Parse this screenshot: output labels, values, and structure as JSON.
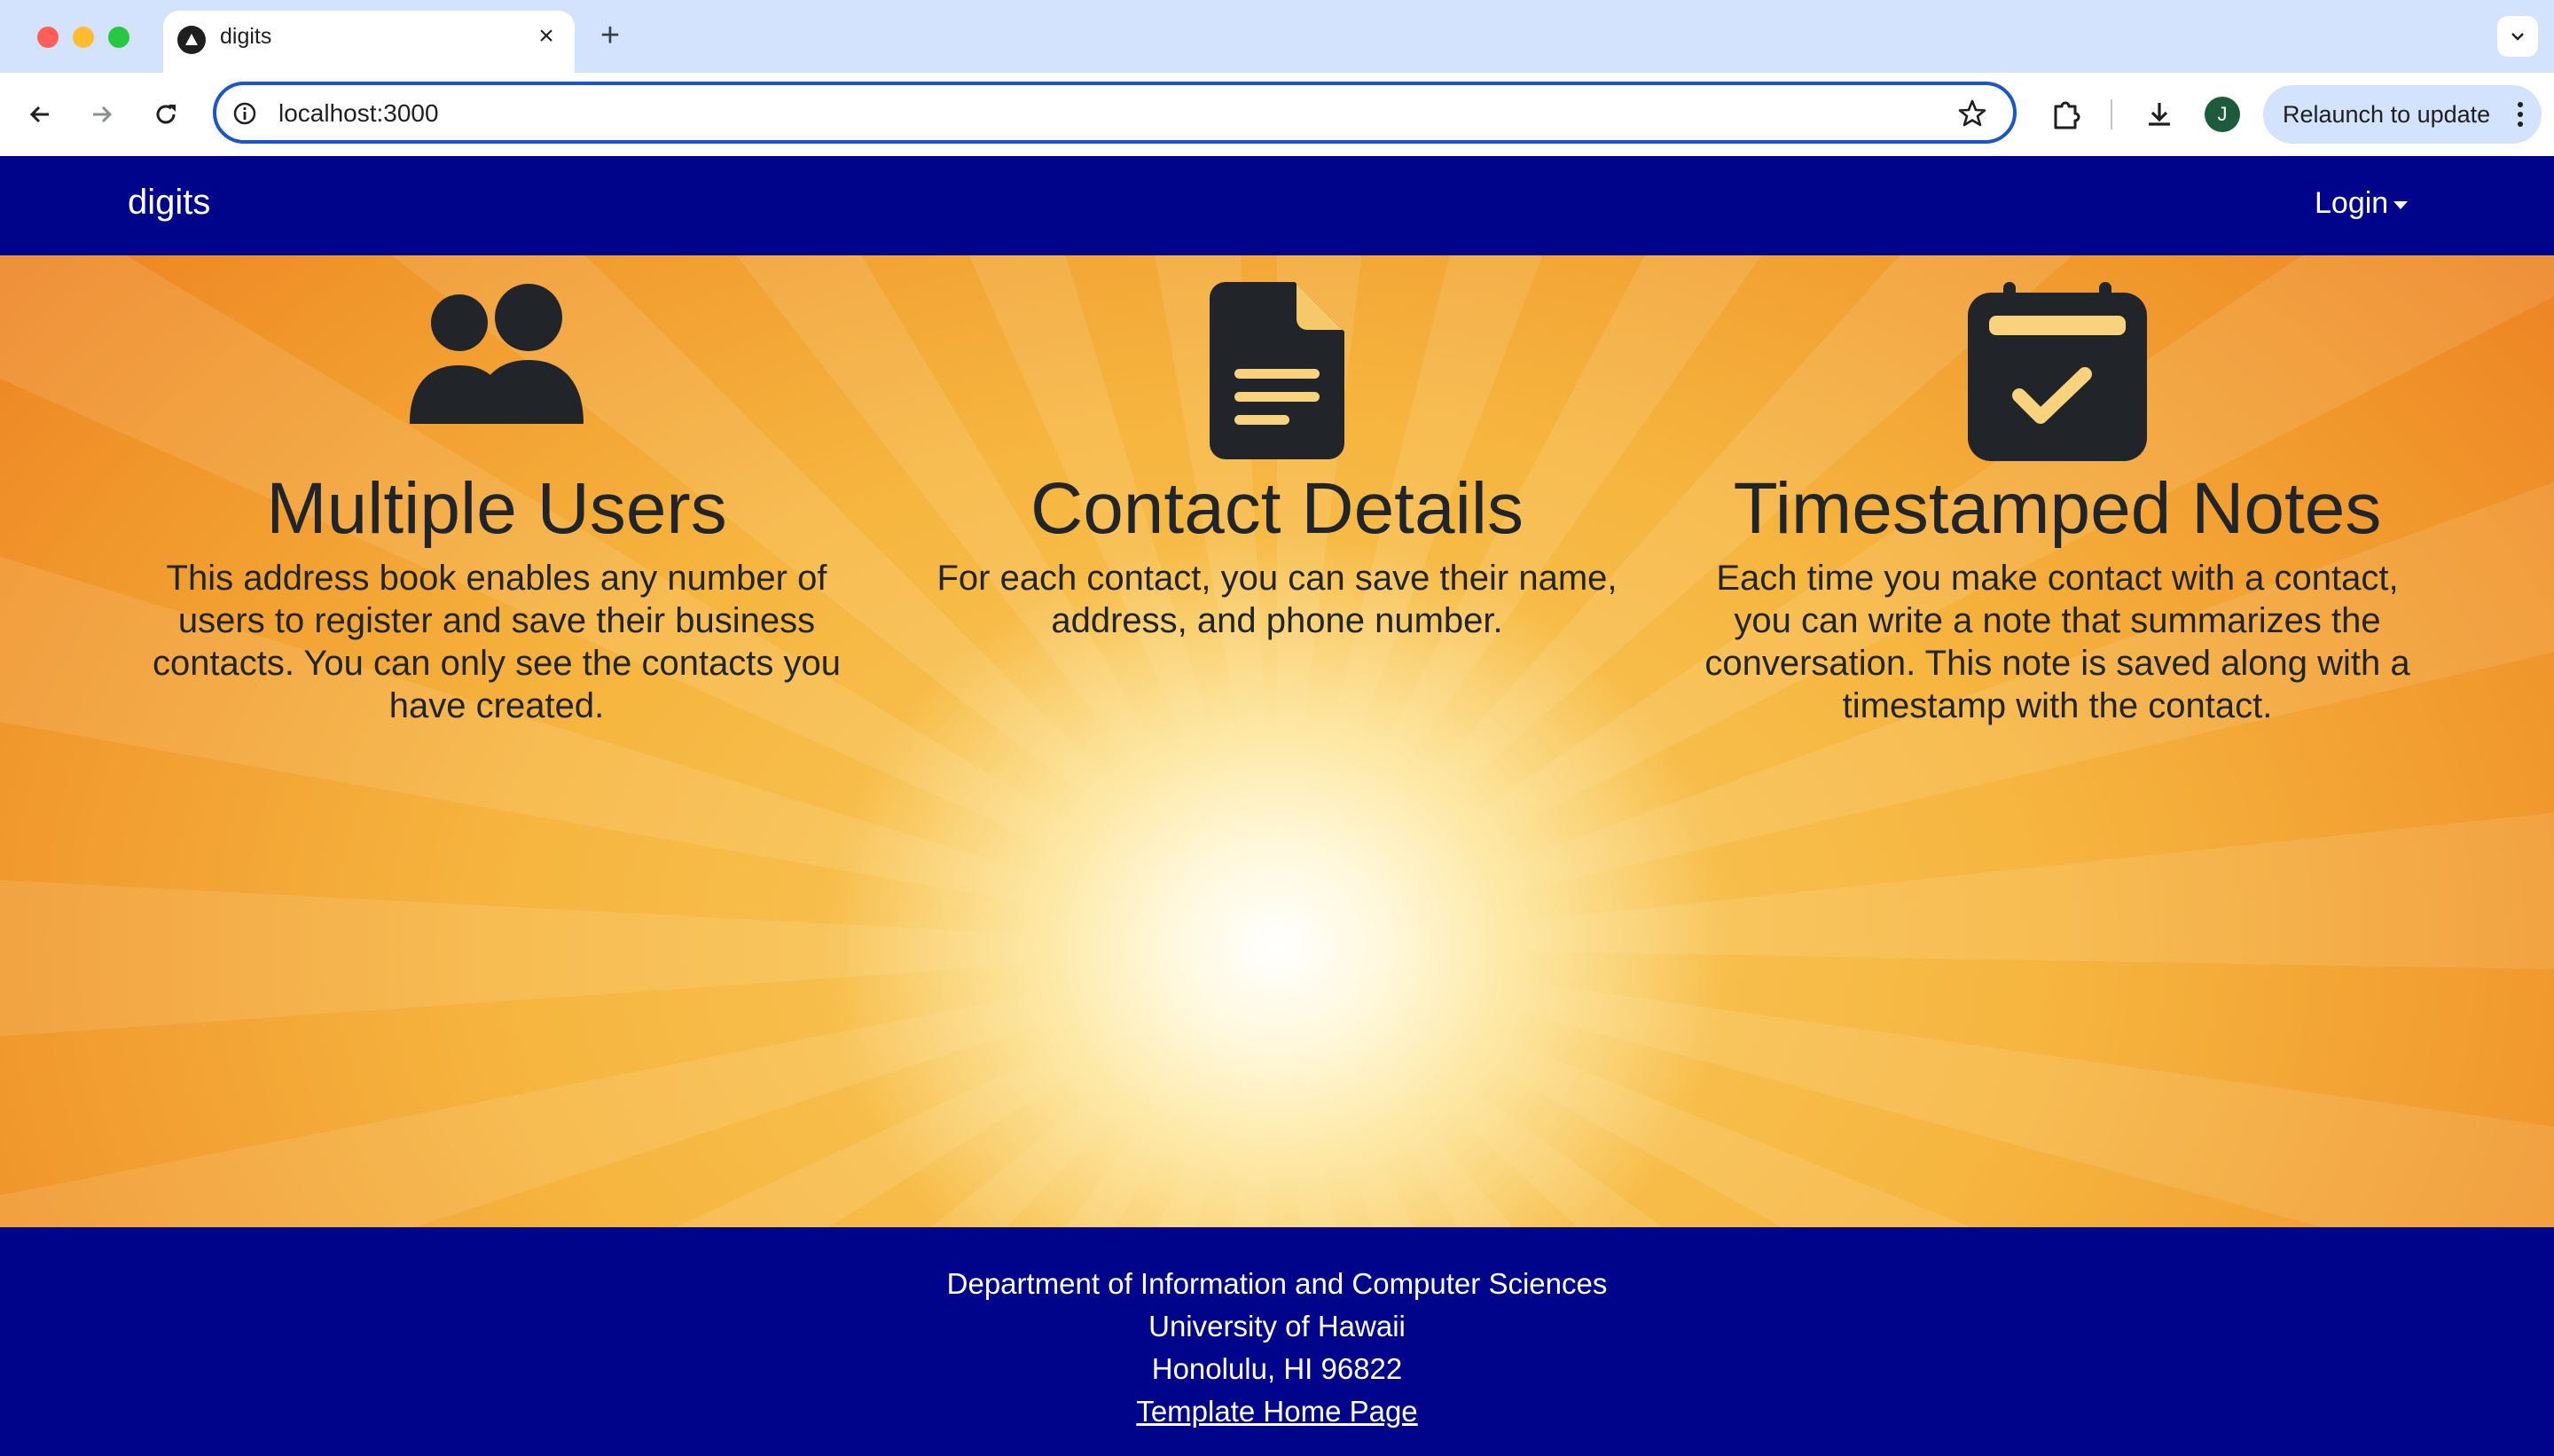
{
  "browser": {
    "tab_title": "digits",
    "url": "localhost:3000",
    "profile_initial": "J",
    "relaunch_label": "Relaunch to update"
  },
  "navbar": {
    "brand": "digits",
    "login_label": "Login"
  },
  "features": [
    {
      "icon": "people-icon",
      "title": "Multiple Users",
      "text": "This address book enables any number of users to register and save their business contacts. You can only see the contacts you have created."
    },
    {
      "icon": "document-icon",
      "title": "Contact Details",
      "text": "For each contact, you can save their name, address, and phone number."
    },
    {
      "icon": "calendar-check-icon",
      "title": "Timestamped Notes",
      "text": "Each time you make contact with a contact, you can write a note that summarizes the conversation. This note is saved along with a timestamp with the contact."
    }
  ],
  "footer": {
    "line1": "Department of Information and Computer Sciences",
    "line2": "University of Hawaii",
    "line3": "Honolulu, HI 96822",
    "link_label": "Template Home Page"
  },
  "colors": {
    "navbar": "#00048b",
    "text_dark": "#212529",
    "hero_orange": "#f0952a"
  }
}
